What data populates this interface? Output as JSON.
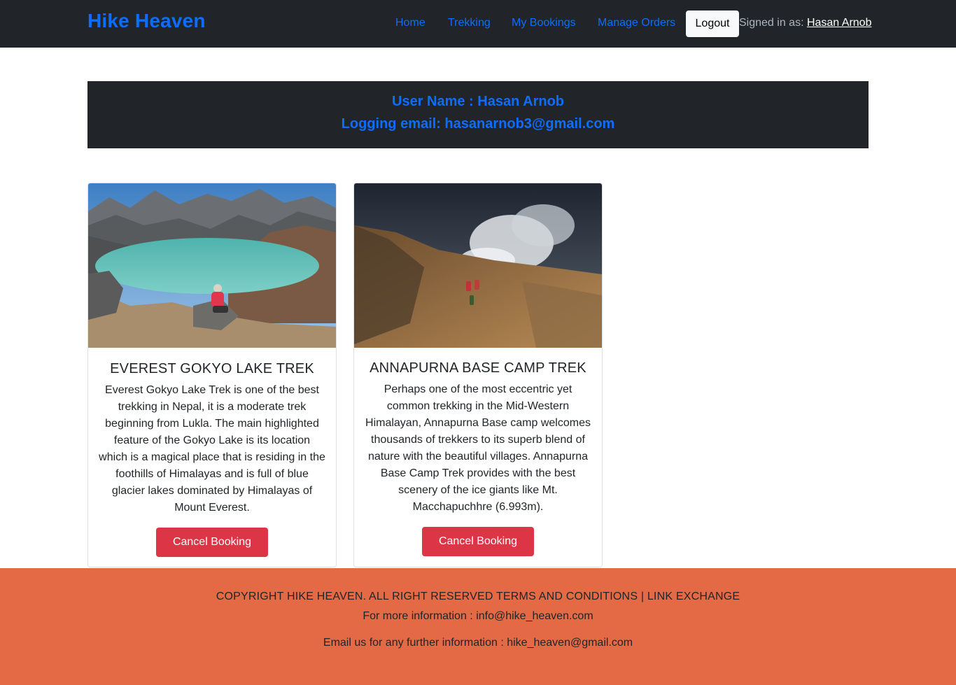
{
  "navbar": {
    "brand": "Hike Heaven",
    "links": [
      {
        "label": "Home"
      },
      {
        "label": "Trekking"
      },
      {
        "label": "My Bookings"
      },
      {
        "label": "Manage Orders"
      }
    ],
    "logout_label": "Logout",
    "signed_in_prefix": "Signed in as: ",
    "signed_in_user": "Hasan Arnob"
  },
  "user_banner": {
    "name_line": "User Name : Hasan Arnob",
    "email_line": "Logging email: hasanarnob3@gmail.com"
  },
  "bookings": [
    {
      "title": "EVEREST GOKYO LAKE TREK",
      "description": "Everest Gokyo Lake Trek is one of the best trekking in Nepal, it is a moderate trek beginning from Lukla. The main highlighted feature of the Gokyo Lake is its location which is a magical place that is residing in the foothills of Himalayas and is full of blue glacier lakes dominated by Himalayas of Mount Everest.",
      "button_label": "Cancel Booking"
    },
    {
      "title": "ANNAPURNA BASE CAMP TREK",
      "description": "Perhaps one of the most eccentric yet common trekking in the Mid-Western Himalayan, Annapurna Base camp welcomes thousands of trekkers to its superb blend of nature with the beautiful villages. Annapurna Base Camp Trek provides with the best scenery of the ice giants like Mt. Macchapuchhre (6.993m).",
      "button_label": "Cancel Booking"
    }
  ],
  "footer": {
    "copyright": "COPYRIGHT HIKE HEAVEN. ALL RIGHT RESERVED TERMS AND CONDITIONS | LINK EXCHANGE",
    "info": "For more information : info@hike_heaven.com",
    "email": "Email us for any further information : hike_heaven@gmail.com"
  },
  "colors": {
    "navbar_bg": "#212529",
    "link_blue": "#0d6efd",
    "danger_red": "#dc3545",
    "footer_orange": "#e36a44"
  }
}
